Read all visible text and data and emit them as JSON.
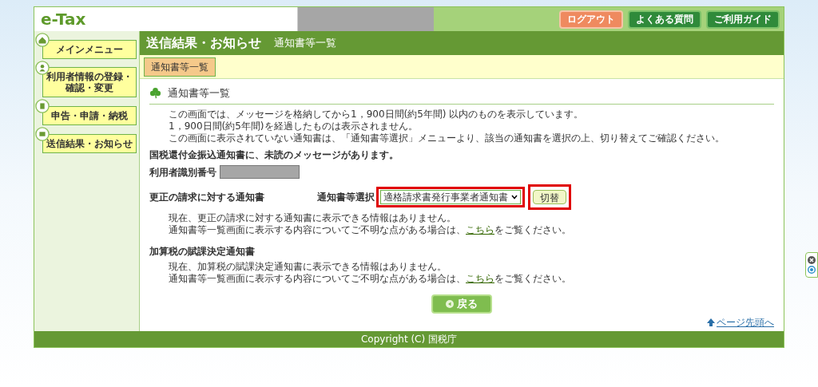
{
  "header": {
    "logo": "e-Tax",
    "buttons": [
      {
        "label": "ログアウト",
        "kind": "logout"
      },
      {
        "label": "よくある質問",
        "kind": "nav"
      },
      {
        "label": "ご利用ガイド",
        "kind": "nav"
      }
    ]
  },
  "sidebar": {
    "items": [
      {
        "label": "メインメニュー"
      },
      {
        "label": "利用者情報の登録・確認・変更"
      },
      {
        "label": "申告・申請・納税"
      },
      {
        "label": "送信結果・お知らせ"
      }
    ]
  },
  "title_bar": {
    "title": "送信結果・お知らせ",
    "subtitle": "通知書等一覧"
  },
  "tabs": [
    {
      "label": "通知書等一覧",
      "selected": true
    }
  ],
  "section": {
    "heading": "通知書等一覧",
    "intro": [
      "この画面では、メッセージを格納してから1，900日間(約5年間) 以内のものを表示しています。",
      "1，900日間(約5年間)を経過したものは表示されません。",
      "この画面に表示されていない通知書は、「通知書等選択」メニューより、該当の通知書を選択の上、切り替えてご確認ください。"
    ],
    "notice": "国税還付金振込通知書に、未読のメッセージがあります。",
    "user_id_label": "利用者識別番号",
    "groups": [
      {
        "title": "更正の請求に対する通知書",
        "select": {
          "label": "通知書等選択",
          "value": "適格請求書発行事業者通知書",
          "button": "切替"
        },
        "lines": [
          "現在、更正の請求に対する通知書に表示できる情報はありません。"
        ],
        "help": {
          "before": "通知書等一覧画面に表示する内容についてご不明な点がある場合は、",
          "link": "こちら",
          "after": "をご覧ください。"
        }
      },
      {
        "title": "加算税の賦課決定通知書",
        "lines": [
          "現在、加算税の賦課決定通知書に表示できる情報はありません。"
        ],
        "help": {
          "before": "通知書等一覧画面に表示する内容についてご不明な点がある場合は、",
          "link": "こちら",
          "after": "をご覧ください。"
        }
      }
    ],
    "back_button": "戻る",
    "page_top_link": "ページ先頭へ"
  },
  "footer": "Copyright (C) 国税庁"
}
